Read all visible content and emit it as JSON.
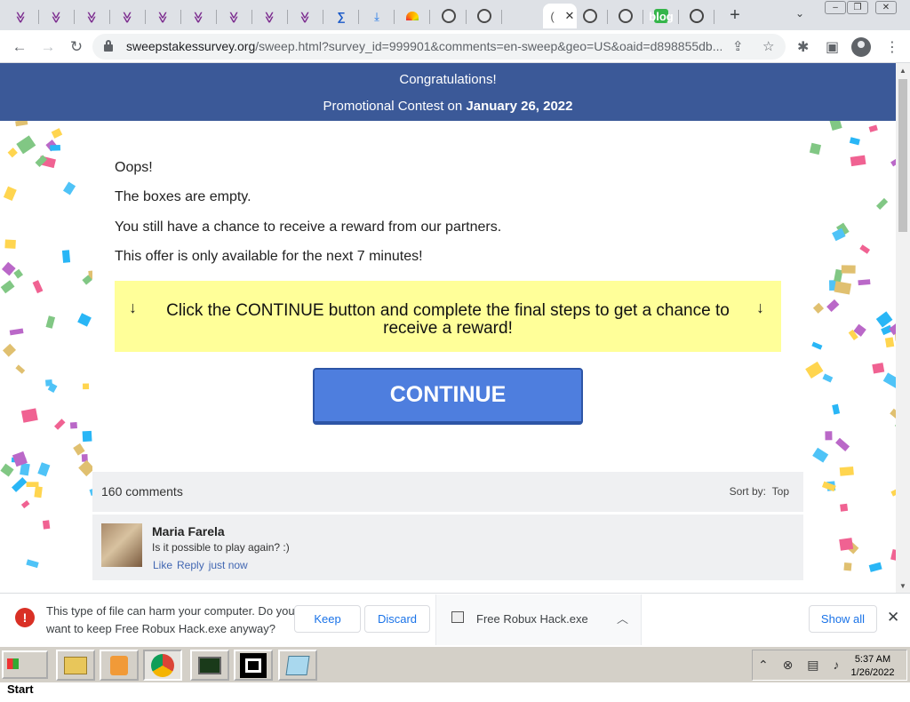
{
  "browser": {
    "tabs": [
      {
        "icon": "chevron-favicon"
      },
      {
        "icon": "chevron-favicon"
      },
      {
        "icon": "chevron-favicon"
      },
      {
        "icon": "chevron-favicon"
      },
      {
        "icon": "chevron-favicon"
      },
      {
        "icon": "chevron-favicon"
      },
      {
        "icon": "chevron-favicon"
      },
      {
        "icon": "chevron-favicon"
      },
      {
        "icon": "chevron-favicon"
      },
      {
        "icon": "sigma-favicon"
      },
      {
        "icon": "download-favicon"
      },
      {
        "icon": "rainbow-favicon"
      },
      {
        "icon": "globe-favicon"
      },
      {
        "icon": "globe-favicon"
      },
      {
        "icon": "loading-favicon",
        "active": true
      },
      {
        "icon": "globe-favicon"
      },
      {
        "icon": "globe-favicon"
      },
      {
        "icon": "blog-favicon"
      },
      {
        "icon": "chrome-favicon"
      }
    ],
    "new_tab_label": "+",
    "blog_label": "blog",
    "url_host": "sweepstakessurvey.org",
    "url_path": "/sweep.html?survey_id=999901&comments=en-sweep&geo=US&oaid=d898855db..."
  },
  "page": {
    "banner_line1": "Congratulations!",
    "banner_line2_prefix": "Promotional Contest on ",
    "banner_date": "January 26, 2022",
    "messages": [
      "Oops!",
      "The boxes are empty.",
      "You still have a chance to receive a reward from our partners.",
      "This offer is only available for the next 7 minutes!"
    ],
    "arrow": "↓",
    "notice": "Click the CONTINUE button and complete the final steps to get a chance to receive a reward!",
    "continue_label": "CONTINUE",
    "comments_count": "160 comments",
    "sort_label": "Sort by:",
    "sort_value": "Top",
    "comment": {
      "name": "Maria Farela",
      "text": "Is it possible to play again? :)",
      "like": "Like",
      "reply": "Reply",
      "time": "just now"
    }
  },
  "download_bar": {
    "warning": "This type of file can harm your computer. Do you want to keep Free Robux Hack.exe anyway?",
    "keep": "Keep",
    "discard": "Discard",
    "file_name": "Free Robux Hack.exe",
    "show_all": "Show all"
  },
  "taskbar": {
    "start": "Start",
    "time": "5:37 AM",
    "date": "1/26/2022"
  },
  "colors": {
    "banner": "#3b5998",
    "notice_bg": "#ffff99",
    "continue_bg": "#4e7ede",
    "warning_red": "#d93025",
    "link_blue": "#1a73e8"
  }
}
